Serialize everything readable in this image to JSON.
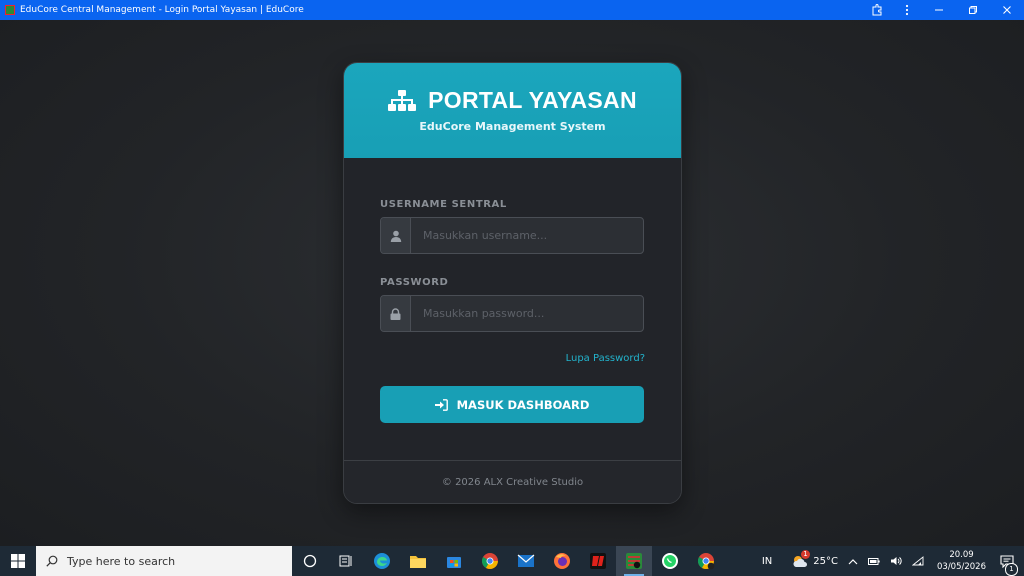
{
  "window": {
    "title": "EduCore Central Management - Login Portal Yayasan | EduCore",
    "controls": [
      "extensions-icon",
      "more-icon",
      "minimize-icon",
      "restore-icon",
      "close-icon"
    ]
  },
  "card": {
    "title": "PORTAL YAYASAN",
    "subtitle": "EduCore Management System",
    "username": {
      "label": "USERNAME SENTRAL",
      "placeholder": "Masukkan username...",
      "value": ""
    },
    "password": {
      "label": "PASSWORD",
      "placeholder": "Masukkan password...",
      "value": ""
    },
    "forgot_link": "Lupa Password?",
    "submit_label": "MASUK DASHBOARD",
    "footer": "© 2026 ALX Creative Studio"
  },
  "colors": {
    "accent": "#189fb5",
    "link": "#22b3cc",
    "card_bg": "#222429",
    "titlebar": "#0a64f0"
  },
  "taskbar": {
    "search_placeholder": "Type here to search",
    "apps": [
      "task-view-icon",
      "widgets-icon",
      "edge-icon",
      "file-explorer-icon",
      "store-icon",
      "chrome-icon",
      "mail-icon",
      "firefox-icon",
      "app-red-icon",
      "educore-app-icon",
      "whatsapp-icon",
      "chrome-profile-icon"
    ],
    "language": "IN",
    "weather": "25°C",
    "weather_badge": "1",
    "time": "20.09",
    "date": "03/05/2026",
    "notification_count": "1"
  }
}
